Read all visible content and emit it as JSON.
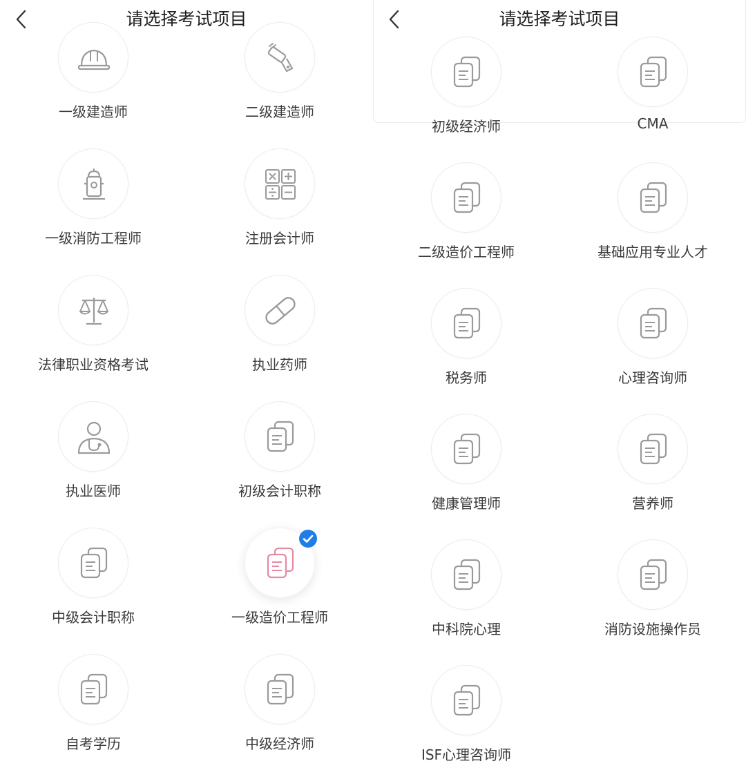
{
  "left_panel": {
    "header": {
      "title": "请选择考试项目",
      "back_icon": "chevron-left-icon"
    },
    "items": [
      {
        "label": "一级建造师",
        "icon": "hard-hat-icon",
        "selected": false
      },
      {
        "label": "二级建造师",
        "icon": "drill-icon",
        "selected": false
      },
      {
        "label": "一级消防工程师",
        "icon": "fire-hydrant-icon",
        "selected": false
      },
      {
        "label": "注册会计师",
        "icon": "calculator-icon",
        "selected": false
      },
      {
        "label": "法律职业资格考试",
        "icon": "scales-icon",
        "selected": false
      },
      {
        "label": "执业药师",
        "icon": "capsule-icon",
        "selected": false
      },
      {
        "label": "执业医师",
        "icon": "doctor-icon",
        "selected": false
      },
      {
        "label": "初级会计职称",
        "icon": "document-stack-icon",
        "selected": false
      },
      {
        "label": "中级会计职称",
        "icon": "document-stack-icon",
        "selected": false
      },
      {
        "label": "一级造价工程师",
        "icon": "document-stack-icon",
        "selected": true
      },
      {
        "label": "自考学历",
        "icon": "document-stack-icon",
        "selected": false
      },
      {
        "label": "中级经济师",
        "icon": "document-stack-icon",
        "selected": false
      }
    ]
  },
  "right_panel": {
    "header": {
      "title": "请选择考试项目",
      "back_icon": "chevron-left-icon"
    },
    "items": [
      {
        "label": "初级经济师",
        "icon": "document-stack-icon",
        "selected": false
      },
      {
        "label": "CMA",
        "icon": "document-stack-icon",
        "selected": false
      },
      {
        "label": "二级造价工程师",
        "icon": "document-stack-icon",
        "selected": false
      },
      {
        "label": "基础应用专业人才",
        "icon": "document-stack-icon",
        "selected": false
      },
      {
        "label": "税务师",
        "icon": "document-stack-icon",
        "selected": false
      },
      {
        "label": "心理咨询师",
        "icon": "document-stack-icon",
        "selected": false
      },
      {
        "label": "健康管理师",
        "icon": "document-stack-icon",
        "selected": false
      },
      {
        "label": "营养师",
        "icon": "document-stack-icon",
        "selected": false
      },
      {
        "label": "中科院心理",
        "icon": "document-stack-icon",
        "selected": false
      },
      {
        "label": "消防设施操作员",
        "icon": "document-stack-icon",
        "selected": false
      },
      {
        "label": "ISF心理咨询师",
        "icon": "document-stack-icon",
        "selected": false
      }
    ]
  },
  "colors": {
    "icon_gray": "#9a9a9a",
    "selected_pink": "#e58aa3",
    "check_blue": "#1f7de6",
    "text": "#3a3a3a",
    "background": "#ffffff"
  }
}
